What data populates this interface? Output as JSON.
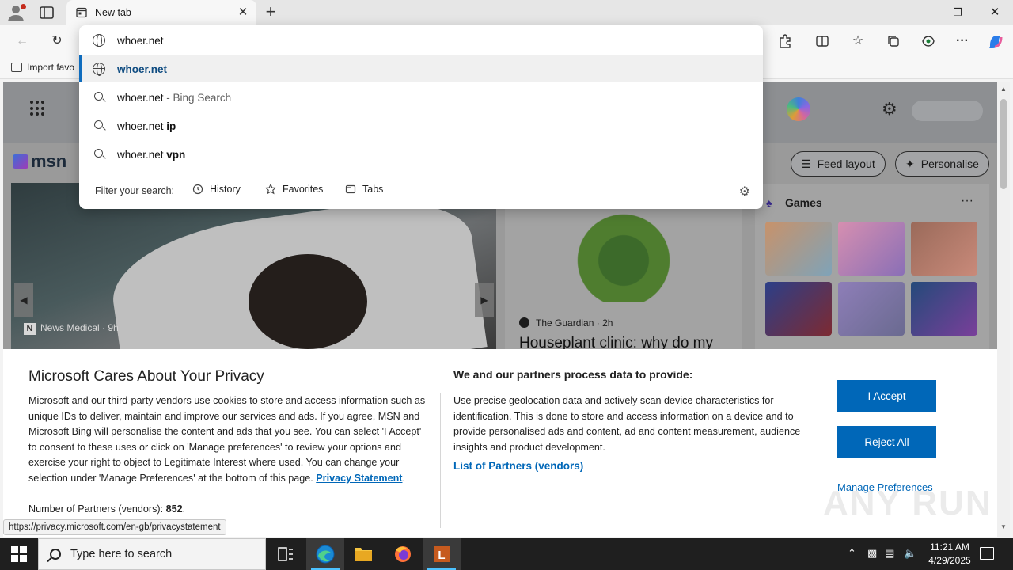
{
  "browser": {
    "tab_title": "New tab",
    "favorites_bar": {
      "import_label": "Import favo"
    }
  },
  "omnibox": {
    "input_value": "whoer.net",
    "suggestions": [
      {
        "text": "whoer.net",
        "suffix": "",
        "type": "url"
      },
      {
        "text": "whoer.net",
        "suffix": " - Bing Search",
        "type": "search"
      },
      {
        "text": "whoer.net ",
        "suffix": "ip",
        "type": "search"
      },
      {
        "text": "whoer.net ",
        "suffix": "vpn",
        "type": "search"
      }
    ],
    "filter_label": "Filter your search:",
    "filters": [
      "History",
      "Favorites",
      "Tabs"
    ]
  },
  "msn": {
    "logo_text": "msn",
    "feed_layout_label": "Feed layout",
    "personalise_label": "Personalise",
    "hero_source": "News Medical",
    "hero_time": "· 9h",
    "card2_source": "The Guardian",
    "card2_time": "· 2h",
    "card2_headline": "Houseplant clinic: why do my",
    "games_title": "Games",
    "games_more": "···"
  },
  "privacy": {
    "title": "Microsoft Cares About Your Privacy",
    "body": "Microsoft and our third-party vendors use cookies to store and access information such as unique IDs to deliver, maintain and improve our services and ads. If you agree, MSN and Microsoft Bing will personalise the content and ads that you see. You can select 'I Accept' to consent to these uses or click on 'Manage preferences' to review your options and exercise your right to object to Legitimate Interest where used.  You can change your selection under 'Manage Preferences' at the bottom of this page.",
    "privacy_statement_link": "Privacy Statement",
    "partners_label": "Number of Partners (vendors): ",
    "partners_count": "852",
    "right_title": "We and our partners process data to provide:",
    "right_body": "Use precise geolocation data and actively scan device characteristics for identification. This is done to store and access information on a device and to provide personalised ads and content, ad and content measurement, audience insights and product development.",
    "partners_link": "List of Partners (vendors)",
    "accept_label": "I Accept",
    "reject_label": "Reject All",
    "manage_label": "Manage Preferences"
  },
  "status_url": "https://privacy.microsoft.com/en-gb/privacystatement",
  "watermark": "ANY RUN",
  "taskbar": {
    "search_placeholder": "Type here to search",
    "time": "11:21 AM",
    "date": "4/29/2025"
  },
  "colors": {
    "accent": "#0067b8",
    "taskbar": "#1f1f1f",
    "active_indicator": "#4cc2ff"
  }
}
